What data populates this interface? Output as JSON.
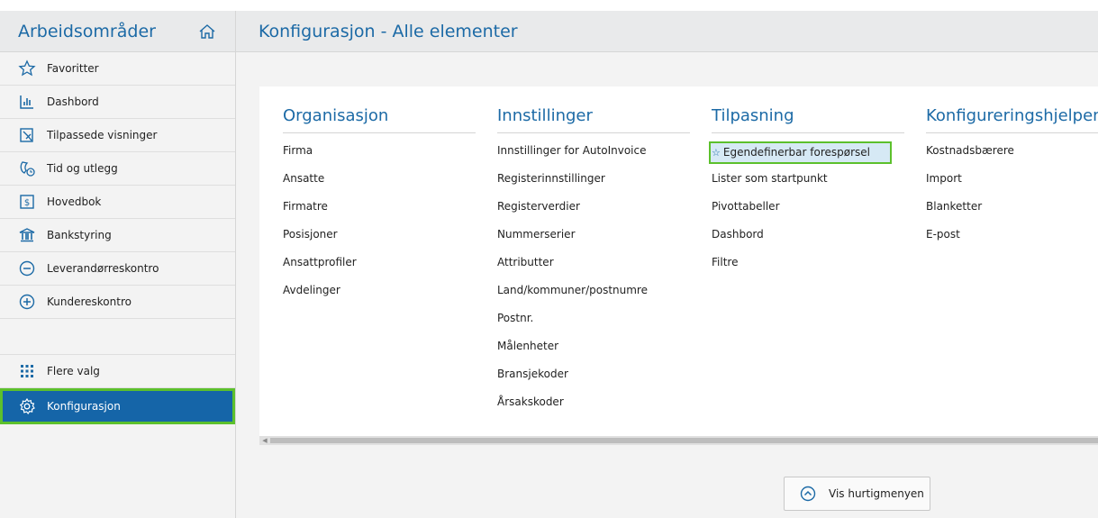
{
  "sidebar": {
    "title": "Arbeidsområder",
    "items": [
      {
        "label": "Favoritter",
        "icon": "star-icon"
      },
      {
        "label": "Dashbord",
        "icon": "bar-chart-icon"
      },
      {
        "label": "Tilpassede visninger",
        "icon": "custom-view-icon"
      },
      {
        "label": "Tid og utlegg",
        "icon": "time-expense-icon"
      },
      {
        "label": "Hovedbok",
        "icon": "ledger-icon"
      },
      {
        "label": "Bankstyring",
        "icon": "bank-icon"
      },
      {
        "label": "Leverandørreskontro",
        "icon": "minus-circle-icon"
      },
      {
        "label": "Kundereskontro",
        "icon": "plus-circle-icon"
      }
    ],
    "more_label": "Flere valg",
    "config_label": "Konfigurasjon"
  },
  "header": {
    "title": "Konfigurasjon - Alle elementer"
  },
  "columns": [
    {
      "title": "Organisasjon",
      "items": [
        "Firma",
        "Ansatte",
        "Firmatre",
        "Posisjoner",
        "Ansattprofiler",
        "Avdelinger"
      ]
    },
    {
      "title": "Innstillinger",
      "items": [
        "Innstillinger for AutoInvoice",
        "Registerinnstillinger",
        "Registerverdier",
        "Nummerserier",
        "Attributter",
        "Land/kommuner/postnumre",
        "Postnr.",
        "Målenheter",
        "Bransjekoder",
        "Årsakskoder"
      ]
    },
    {
      "title": "Tilpasning",
      "items": [
        "Egendefinerbar forespørsel",
        "Lister som startpunkt",
        "Pivottabeller",
        "Dashbord",
        "Filtre"
      ]
    },
    {
      "title": "Konfigureringshjelpen",
      "items": [
        "Kostnadsbærere",
        "Import",
        "Blanketter",
        "E-post"
      ]
    }
  ],
  "quick_menu": {
    "label": "Vis hurtigmenyen"
  },
  "colors": {
    "accent": "#1c6aa6",
    "active_bg": "#1565a8",
    "highlight_border": "#5cc02c"
  }
}
